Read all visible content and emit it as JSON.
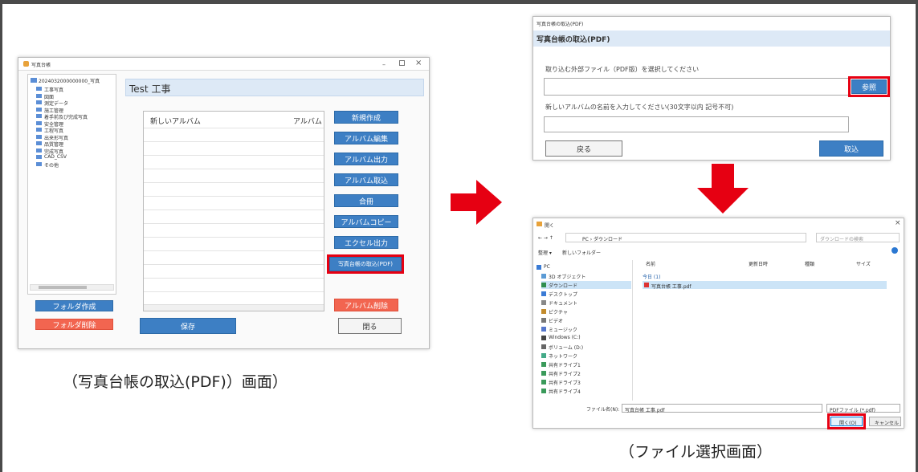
{
  "main_app": {
    "window_title": "写真台帳",
    "close_glyph": "×",
    "tree_root": "2024032000000000_写真",
    "tree_items": [
      "工事写真",
      "図面",
      "測定データ",
      "施工管理",
      "着手前及び完成写真",
      "安全管理",
      "工程写真",
      "出来形写真",
      "品質管理",
      "完成写真",
      "CAD_CSV",
      "その他"
    ],
    "header_title": "Test 工事",
    "table_col1": "新しいアルバム",
    "table_col2": "アルバム",
    "buttons": {
      "new": "新規作成",
      "edit": "アルバム編集",
      "output": "アルバム出力",
      "import": "アルバム取込",
      "merge": "合冊",
      "copy": "アルバムコピー",
      "excel": "エクセル出力",
      "pdf_import": "写真台帳の取込(PDF)",
      "delete_album": "アルバム削除",
      "folder_create": "フォルダ作成",
      "folder_delete": "フォルダ削除",
      "save": "保存",
      "close": "閉る"
    }
  },
  "pdf_dialog": {
    "window_title": "写真台帳の取込(PDF)",
    "section_title": "写真台帳の取込(PDF)",
    "file_label": "取り込む外部ファイル（PDF版）を選択してください",
    "browse": "参照",
    "name_label": "新しいアルバムの名前を入力してください(30文字以内 記号不可)",
    "back": "戻る",
    "import": "取込"
  },
  "file_dialog": {
    "title": "開く",
    "path": "PC › ダウンロード",
    "search_placeholder": "ダウンロードの検索",
    "organize": "整理 ▾",
    "new_folder": "新しいフォルダー",
    "columns": [
      "名前",
      "更新日時",
      "種類",
      "サイズ"
    ],
    "group_label": "今日 (1)",
    "file_row": "写真台帳 工事.pdf",
    "nav": [
      "PC",
      "3D オブジェクト",
      "ダウンロード",
      "デスクトップ",
      "ドキュメント",
      "ピクチャ",
      "ビデオ",
      "ミュージック",
      "Windows (C:)",
      "ボリューム (D:)",
      "ネットワーク",
      "共有ドライブ1",
      "共有ドライブ2",
      "共有ドライブ3",
      "共有ドライブ4"
    ],
    "filename_label": "ファイル名(N):",
    "filename_value": "写真台帳 工事.pdf",
    "filter": "PDFファイル (*.pdf)",
    "open": "開く(O)",
    "cancel": "キャンセル"
  },
  "captions": {
    "left": "（写真台帳の取込(PDF)）画面）",
    "right": "（ファイル選択画面）"
  },
  "colors": {
    "arrow_red": "#e60012",
    "button_blue": "#3d7fc4",
    "button_red": "#f26550",
    "highlight": "#e60012"
  }
}
